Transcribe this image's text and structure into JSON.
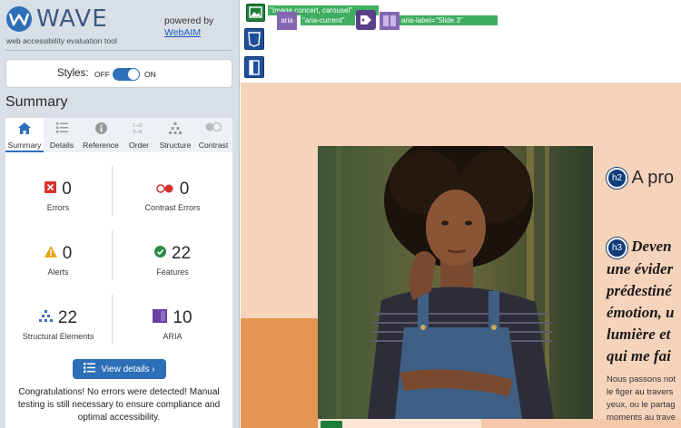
{
  "sidebar": {
    "logo": {
      "word": "WAVE",
      "tagline": "web accessibility evaluation tool"
    },
    "powered_by": "powered by",
    "webaim_link": "WebAIM",
    "styles": {
      "label": "Styles:",
      "off": "OFF",
      "on": "ON",
      "state": "on"
    },
    "summary_heading": "Summary",
    "tabs": [
      {
        "label": "Summary",
        "icon": "home-icon",
        "active": true
      },
      {
        "label": "Details",
        "icon": "list-icon"
      },
      {
        "label": "Reference",
        "icon": "info-icon"
      },
      {
        "label": "Order",
        "icon": "order-icon"
      },
      {
        "label": "Structure",
        "icon": "structure-icon"
      },
      {
        "label": "Contrast",
        "icon": "contrast-icon"
      }
    ],
    "stats": {
      "errors": {
        "count": "0",
        "label": "Errors",
        "color": "#d6312b"
      },
      "contrast_errors": {
        "count": "0",
        "label": "Contrast Errors",
        "color": "#d6312b"
      },
      "alerts": {
        "count": "0",
        "label": "Alerts",
        "color": "#e8a317"
      },
      "features": {
        "count": "22",
        "label": "Features",
        "color": "#2f8a48"
      },
      "structural": {
        "count": "22",
        "label": "Structural Elements",
        "color": "#3c6fb5"
      },
      "aria": {
        "count": "10",
        "label": "ARIA",
        "color": "#6a3ea1"
      }
    },
    "view_details": "View details ›",
    "congrats": "Congratulations! No errors were detected! Manual testing is still necessary to ensure compliance and optimal accessibility."
  },
  "page": {
    "labels": {
      "image_alt": "\"Image concert, carousel\"",
      "aria": "aria",
      "aria_current": "\"aria-current\"",
      "aria_label": "aria-label=\"Slide 3\""
    },
    "h2_badge": "h2",
    "h2_text": "A pro",
    "h3_badge": "h3",
    "h3_lines": [
      "Deven",
      "une évider",
      "prédestiné",
      "émotion, u",
      "lumière et",
      "qui me fai"
    ],
    "body_lines": [
      "Nous passons not",
      "le figer au travers",
      "yeux, ou le partag",
      "moments au trave"
    ]
  },
  "colors": {
    "accent": "#2d6fb7",
    "sidebar_bg": "#d9dfe6",
    "peach": "#f6d3bb",
    "orange": "#e49554"
  }
}
